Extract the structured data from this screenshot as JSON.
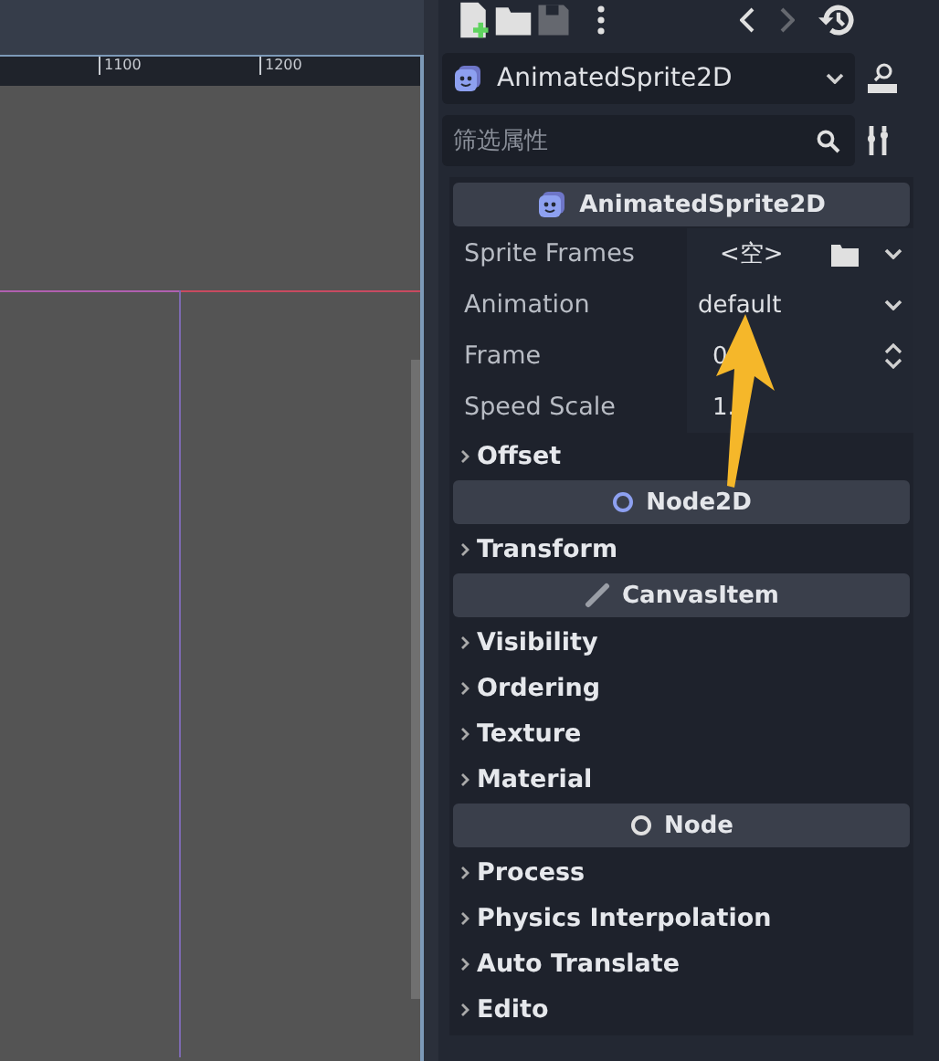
{
  "ruler": {
    "ticks": [
      "1100",
      "1200"
    ]
  },
  "toolbar": {
    "buttons": [
      {
        "kind": "new",
        "disabled": false
      },
      {
        "kind": "open",
        "disabled": false
      },
      {
        "kind": "save",
        "disabled": true
      },
      {
        "kind": "more",
        "disabled": false
      },
      {
        "kind": "back",
        "disabled": false
      },
      {
        "kind": "forward",
        "disabled": true
      },
      {
        "kind": "history",
        "disabled": false
      }
    ]
  },
  "node_selector": {
    "value": "AnimatedSprite2D"
  },
  "filter": {
    "placeholder": "筛选属性"
  },
  "inspector": [
    {
      "kind": "sprite",
      "title": "AnimatedSprite2D"
    },
    {
      "kind": "resource",
      "label": "Sprite Frames",
      "value": "<空>"
    },
    {
      "kind": "dropdown",
      "label": "Animation",
      "value": "default"
    },
    {
      "kind": "spin",
      "label": "Frame",
      "value": "0"
    },
    {
      "kind": "number",
      "label": "Speed Scale",
      "value": "1."
    },
    {
      "kind": "group",
      "label": "Offset"
    },
    {
      "kind": "node2d",
      "title": "Node2D"
    },
    {
      "kind": "group",
      "label": "Transform"
    },
    {
      "kind": "canvasitem",
      "title": "CanvasItem"
    },
    {
      "kind": "group",
      "label": "Visibility"
    },
    {
      "kind": "group",
      "label": "Ordering"
    },
    {
      "kind": "group",
      "label": "Texture"
    },
    {
      "kind": "group",
      "label": "Material"
    },
    {
      "kind": "node",
      "title": "Node"
    },
    {
      "kind": "group",
      "label": "Process"
    },
    {
      "kind": "group",
      "label": "Physics Interpolation"
    },
    {
      "kind": "group",
      "label": "Auto Translate"
    },
    {
      "kind": "group",
      "label": "Edito"
    }
  ]
}
